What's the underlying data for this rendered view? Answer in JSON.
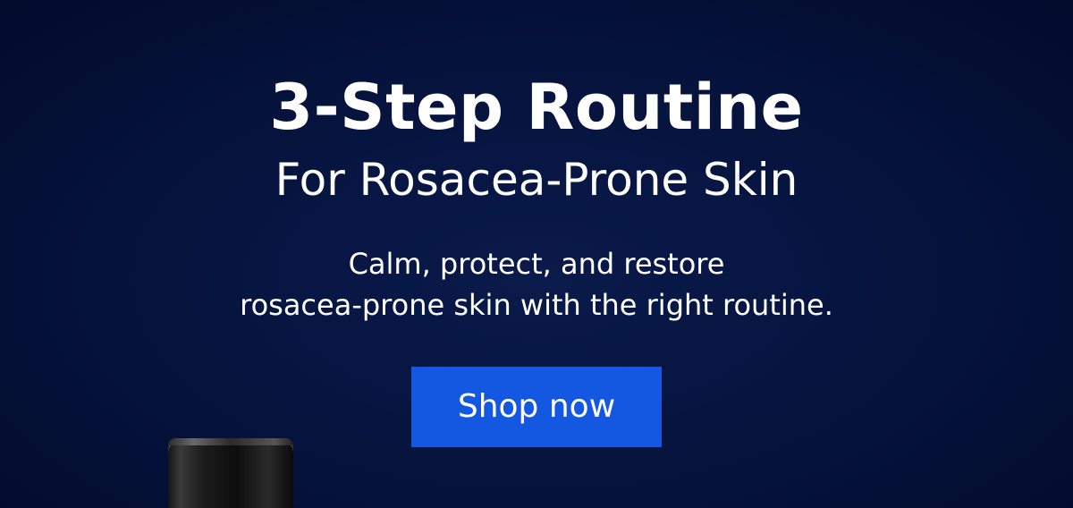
{
  "banner": {
    "title": "3-Step Routine",
    "subtitle": "For Rosacea-Prone Skin",
    "description_line1": "Calm, protect, and restore",
    "description_line2": "rosacea-prone skin with the right routine.",
    "cta_label": "Shop now",
    "colors": {
      "background": "#06143f",
      "cta": "#1457e0",
      "text": "#ffffff"
    },
    "product_image": "dark-skincare-jar"
  }
}
